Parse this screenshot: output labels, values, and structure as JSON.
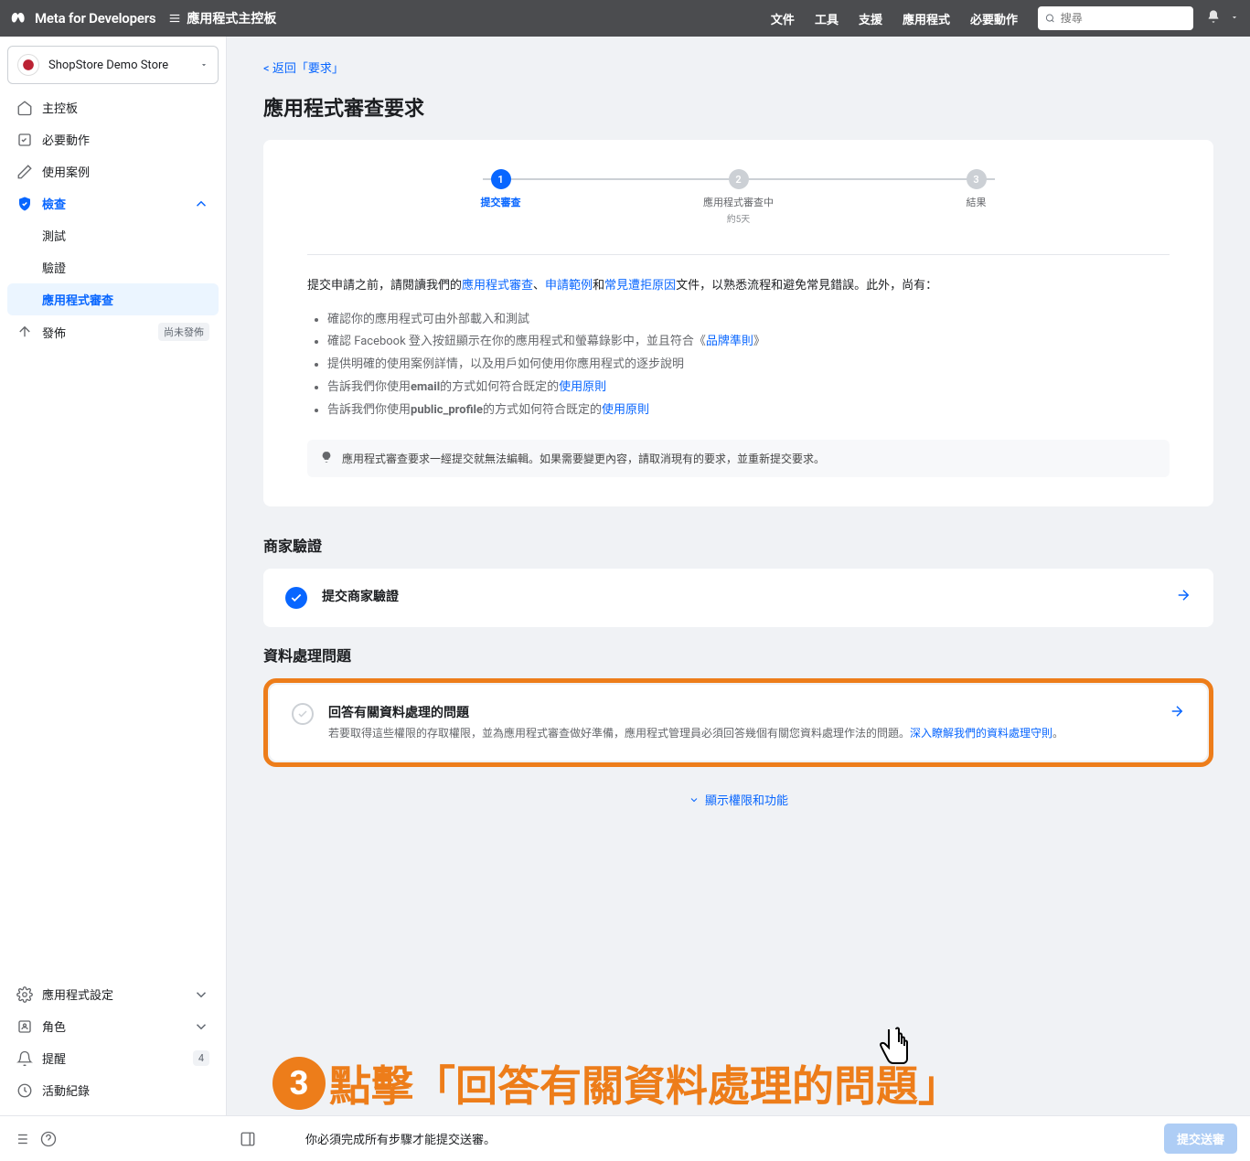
{
  "topnav": {
    "brand": "Meta for Developers",
    "console": "應用程式主控板",
    "links": [
      "文件",
      "工具",
      "支援",
      "應用程式",
      "必要動作"
    ],
    "search_placeholder": "搜尋"
  },
  "sidebar": {
    "app_name": "ShopStore Demo Store",
    "items": [
      {
        "label": "主控板"
      },
      {
        "label": "必要動作"
      },
      {
        "label": "使用案例"
      },
      {
        "label": "檢查",
        "active": true,
        "expanded": true
      },
      {
        "label": "發佈",
        "chip": "尚未發佈"
      }
    ],
    "sub_items": [
      {
        "label": "測試"
      },
      {
        "label": "驗證"
      },
      {
        "label": "應用程式審查",
        "active": true
      }
    ],
    "bottom_items": [
      {
        "label": "應用程式設定"
      },
      {
        "label": "角色"
      },
      {
        "label": "提醒",
        "count": "4"
      },
      {
        "label": "活動紀錄"
      }
    ]
  },
  "main": {
    "back": "< 返回「要求」",
    "title": "應用程式審查要求",
    "steps": [
      {
        "num": "1",
        "label": "提交審查",
        "active": true
      },
      {
        "num": "2",
        "label": "應用程式審查中",
        "sub": "約5天"
      },
      {
        "num": "3",
        "label": "結果"
      }
    ],
    "intro_prefix": "提交申請之前，請閱讀我們的",
    "intro_link1": "應用程式審查",
    "intro_sep1": "、",
    "intro_link2": "申請範例",
    "intro_sep2": "和",
    "intro_link3": "常見遭拒原因",
    "intro_suffix": "文件，以熟悉流程和避免常見錯誤。此外，尚有：",
    "bullets": [
      {
        "t1": "確認你的應用程式可由外部載入和測試"
      },
      {
        "t1": "確認 Facebook 登入按鈕顯示在你的應用程式和螢幕錄影中，並且符合《",
        "link": "品牌準則",
        "t2": "》"
      },
      {
        "t1": "提供明確的使用案例詳情，以及用戶如何使用你應用程式的逐步說明"
      },
      {
        "t1": "告訴我們你使用",
        "bold": "email",
        "t2": "的方式如何符合既定的",
        "link": "使用原則"
      },
      {
        "t1": "告訴我們你使用",
        "bold": "public_profile",
        "t2": "的方式如何符合既定的",
        "link": "使用原則"
      }
    ],
    "banner": "應用程式審查要求一經提交就無法編輯。如果需要變更內容，請取消現有的要求，並重新提交要求。",
    "section2": "商家驗證",
    "panel2_title": "提交商家驗證",
    "section3": "資料處理問題",
    "panel3_title": "回答有關資料處理的問題",
    "panel3_desc_1": "若要取得這些權限的存取權限，並為應用程式審查做好準備，應用程式管理員必須回答幾個有關您資料處理作法的問題。",
    "panel3_link": "深入瞭解我們的資料處理守則",
    "panel3_desc_2": "。",
    "expand": "顯示權限和功能"
  },
  "footer": {
    "msg": "你必須完成所有步驟才能提交送審。",
    "submit": "提交送審"
  },
  "annotation": {
    "num": "3",
    "text": "點擊「回答有關資料處理的問題」"
  }
}
